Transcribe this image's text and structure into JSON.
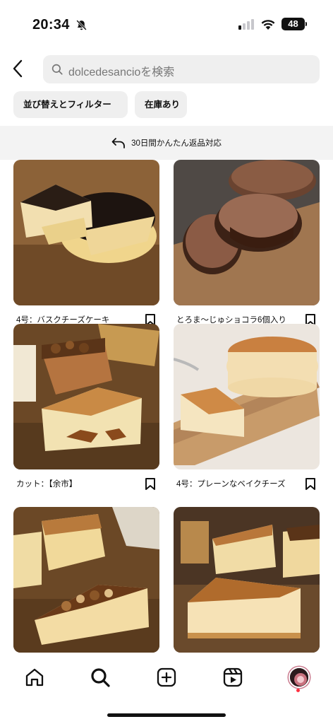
{
  "status_bar": {
    "time": "20:34",
    "battery": "48",
    "icons": [
      "bell-off-icon",
      "cellular-signal-icon",
      "wifi-icon",
      "battery-icon"
    ]
  },
  "header": {
    "back_icon": "chevron-left-icon",
    "search_placeholder": "dolcedesancioを検索"
  },
  "filters": {
    "sort_label": "並び替えとフィルター",
    "stock_label": "在庫あり"
  },
  "banner": {
    "return_text": "30日間かんたん返品対応"
  },
  "products": [
    {
      "title": "4号：バスクチーズケーキ"
    },
    {
      "title": "とろま〜じゅショコラ6個入り"
    },
    {
      "title": "カット：【余市】"
    },
    {
      "title": "4号：プレーンなベイクチーズ"
    },
    {
      "title": ""
    },
    {
      "title": ""
    }
  ],
  "bottom_nav": {
    "items": [
      "home-icon",
      "search-icon",
      "create-icon",
      "reels-icon",
      "profile-avatar"
    ]
  }
}
